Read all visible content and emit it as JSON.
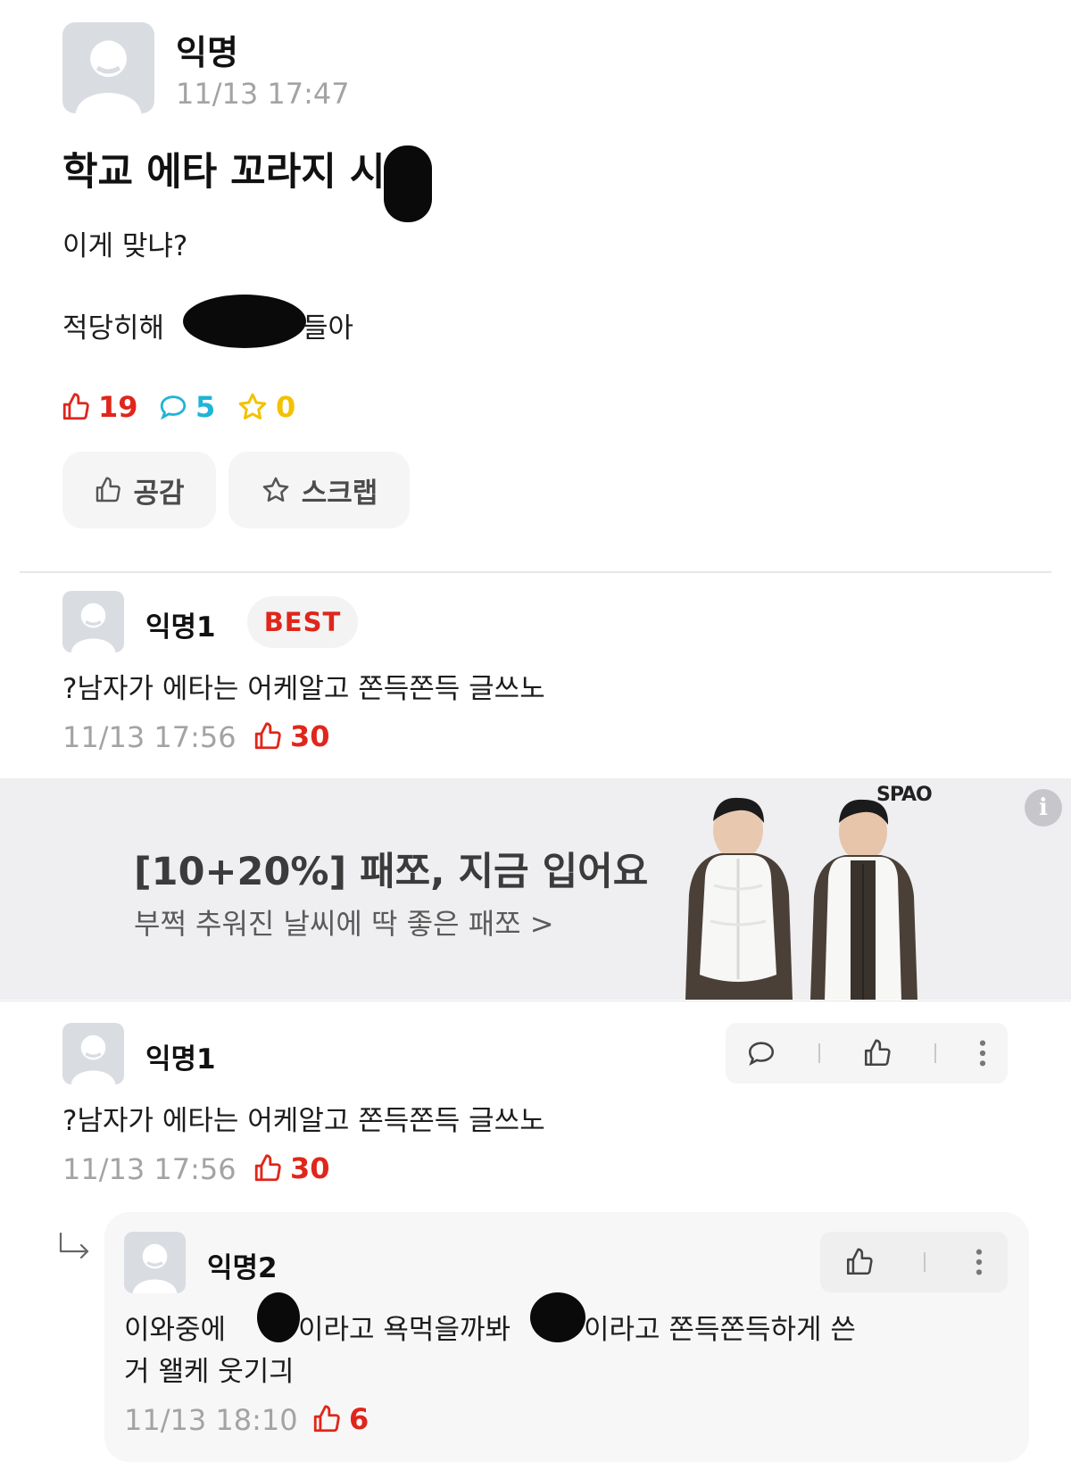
{
  "post": {
    "author": "익명",
    "time": "11/13 17:47",
    "title": "학교 에타 꼬라지 시",
    "body_line1": "이게 맞냐?",
    "body_line2_start": "적당히해 ",
    "body_line2_end": "들아",
    "likes": "19",
    "comments": "5",
    "scraps": "0",
    "like_button": "공감",
    "scrap_button": "스크랩"
  },
  "best_comment": {
    "author": "익명1",
    "badge": "BEST",
    "text": "?남자가 에타는 어케알고 쫀득쫀득 글쓰노",
    "time": "11/13 17:56",
    "likes": "30"
  },
  "ad": {
    "brand": "SPAO",
    "headline": "[10+20%] 패쪼, 지금 입어요",
    "subline": "부쩍 추워진 날씨에 딱 좋은 패쪼 >",
    "info_icon": "i"
  },
  "comment": {
    "author": "익명1",
    "text": "?남자가 에타는 어케알고 쫀득쫀득 글쓰노",
    "time": "11/13 17:56",
    "likes": "30"
  },
  "reply": {
    "author": "익명2",
    "text_part1": "이와중에 ",
    "text_part2": "이라고 욕먹을까봐 ",
    "text_part3": "이라고 쫀득쫀득하게 쓴",
    "text_line2": "거 왤케 웃기긔",
    "time": "11/13 18:10",
    "likes": "6"
  },
  "colors": {
    "like_red": "#e0261b",
    "comment_cyan": "#1fb5d6",
    "scrap_yellow": "#f2c200",
    "meta_gray": "#a3a3a3",
    "ad_bg": "#efeff1"
  },
  "icons": [
    "avatar-icon",
    "thumbs-up-icon",
    "speech-bubble-icon",
    "star-icon",
    "more-vertical-icon",
    "reply-arrow-icon",
    "info-icon"
  ]
}
